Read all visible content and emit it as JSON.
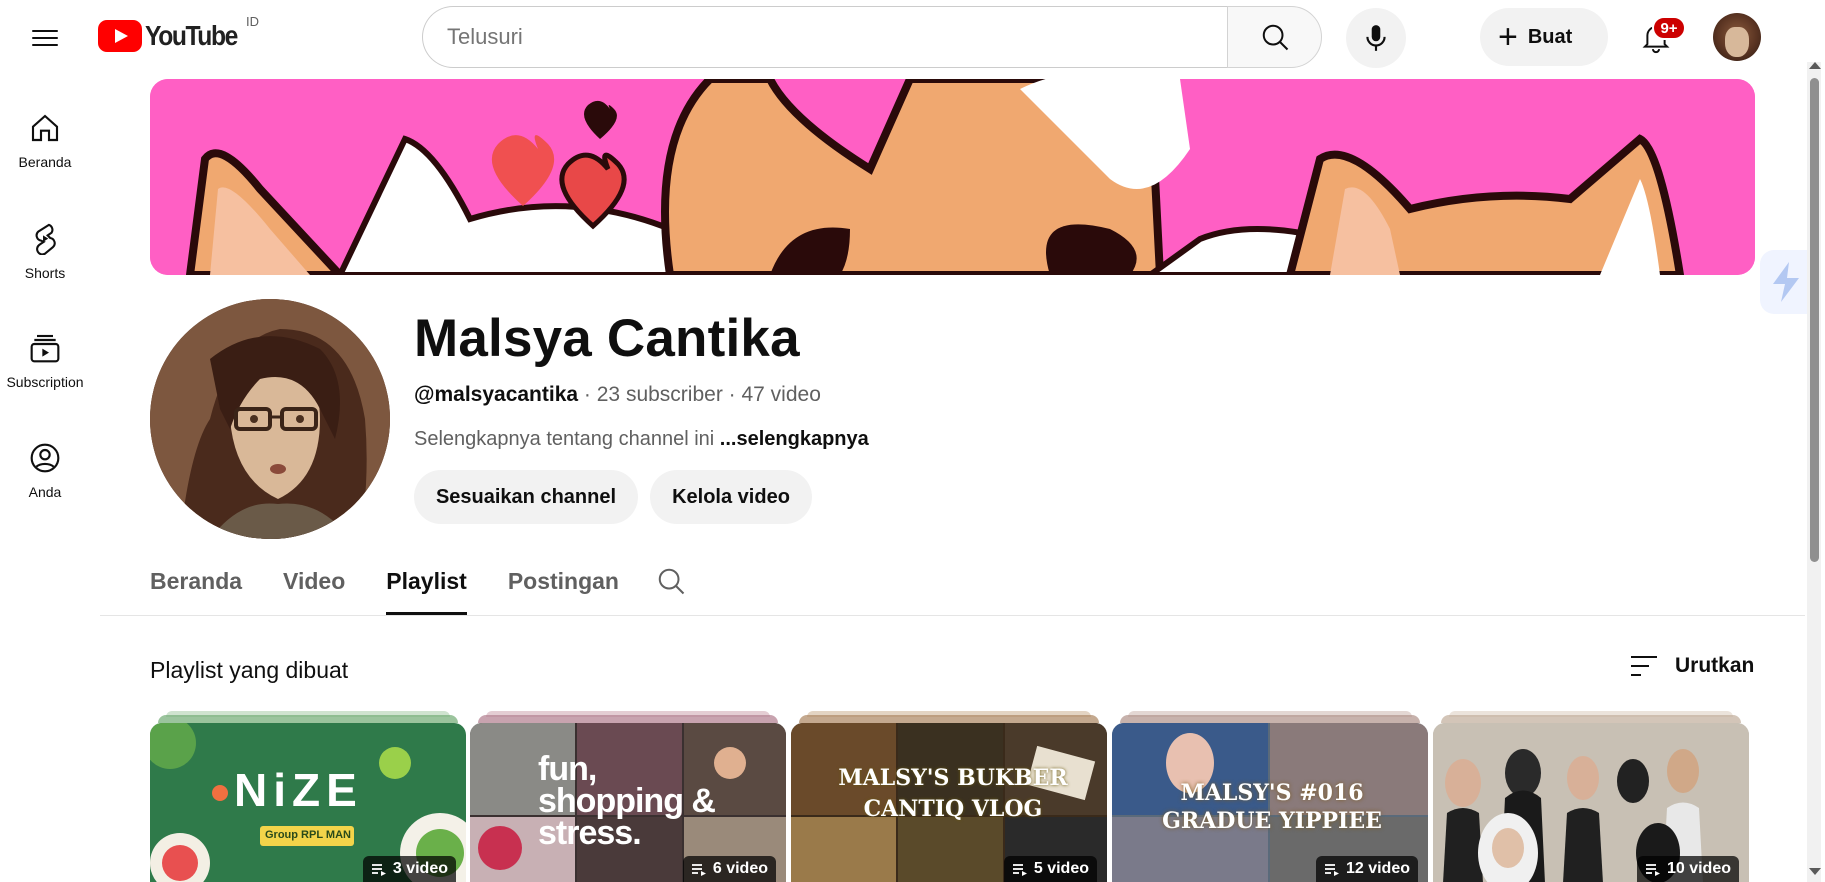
{
  "header": {
    "logo_text": "YouTube",
    "country": "ID",
    "search_placeholder": "Telusuri",
    "create_label": "Buat",
    "notification_count": "9+"
  },
  "leftnav": {
    "items": [
      {
        "label": "Beranda",
        "icon": "home-icon"
      },
      {
        "label": "Shorts",
        "icon": "shorts-icon"
      },
      {
        "label": "Subscription",
        "icon": "subscriptions-icon"
      },
      {
        "label": "Anda",
        "icon": "account-icon"
      }
    ]
  },
  "channel": {
    "name": "Malsya Cantika",
    "handle": "@malsyacantika",
    "subscribers": "23 subscriber",
    "videos": "47 video",
    "separator": " · ",
    "description": "Selengkapnya tentang channel ini",
    "more": "...selengkapnya",
    "customize_label": "Sesuaikan channel",
    "manage_label": "Kelola video"
  },
  "tabs": [
    {
      "label": "Beranda",
      "active": false
    },
    {
      "label": "Video",
      "active": false
    },
    {
      "label": "Playlist",
      "active": true
    },
    {
      "label": "Postingan",
      "active": false
    }
  ],
  "section": {
    "title": "Playlist yang dibuat",
    "sort_label": "Urutkan"
  },
  "playlists": [
    {
      "count": "3 video",
      "thumb_text": "NiZE",
      "thumb_sub": "Group RPL MAN"
    },
    {
      "count": "6 video",
      "thumb_text": "fun, shopping & stress."
    },
    {
      "count": "5 video",
      "thumb_text": "MALSY'S BUKBER CANTIQ VLOG"
    },
    {
      "count": "12 video",
      "thumb_text": "MALSY'S #016 GRADUE YIPPIEE"
    },
    {
      "count": "10 video"
    }
  ],
  "colors": {
    "brand_red": "#ff0000",
    "banner_pink": "#ff5fc4",
    "badge_red": "#cc0000"
  }
}
